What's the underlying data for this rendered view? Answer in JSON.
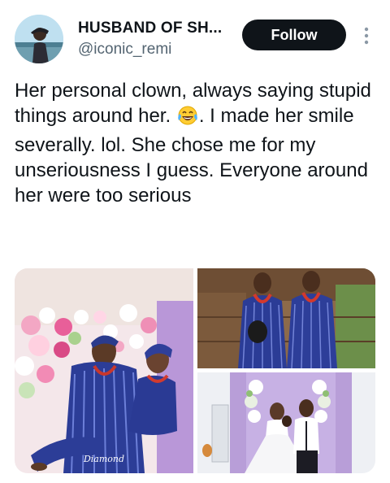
{
  "author": {
    "display_name": "HUSBAND OF SH...",
    "handle": "@iconic_remi"
  },
  "actions": {
    "follow_label": "Follow",
    "more_icon": "more-vertical-icon"
  },
  "tweet": {
    "text_before_emoji": "Her personal clown, always saying stupid things around her. ",
    "emoji": "face-with-tears-of-joy",
    "text_after_emoji": ". I made her smile severally. lol. She chose me for my unseriousness I guess. Everyone around her were too serious"
  },
  "media": {
    "count": 3,
    "photos": [
      {
        "id": "photo-1",
        "subject": "couple in blue traditional attire, groom carrying bride, flower wall"
      },
      {
        "id": "photo-2",
        "subject": "couple in blue aso-oke with coral beads, outdoors"
      },
      {
        "id": "photo-3",
        "subject": "couple in white gown and suit, floral arch, purple backdrop"
      }
    ],
    "watermark_text": "Diamond"
  },
  "colors": {
    "follow_bg": "#0f1419",
    "follow_text": "#ffffff",
    "handle": "#536471",
    "text": "#0f1419"
  }
}
